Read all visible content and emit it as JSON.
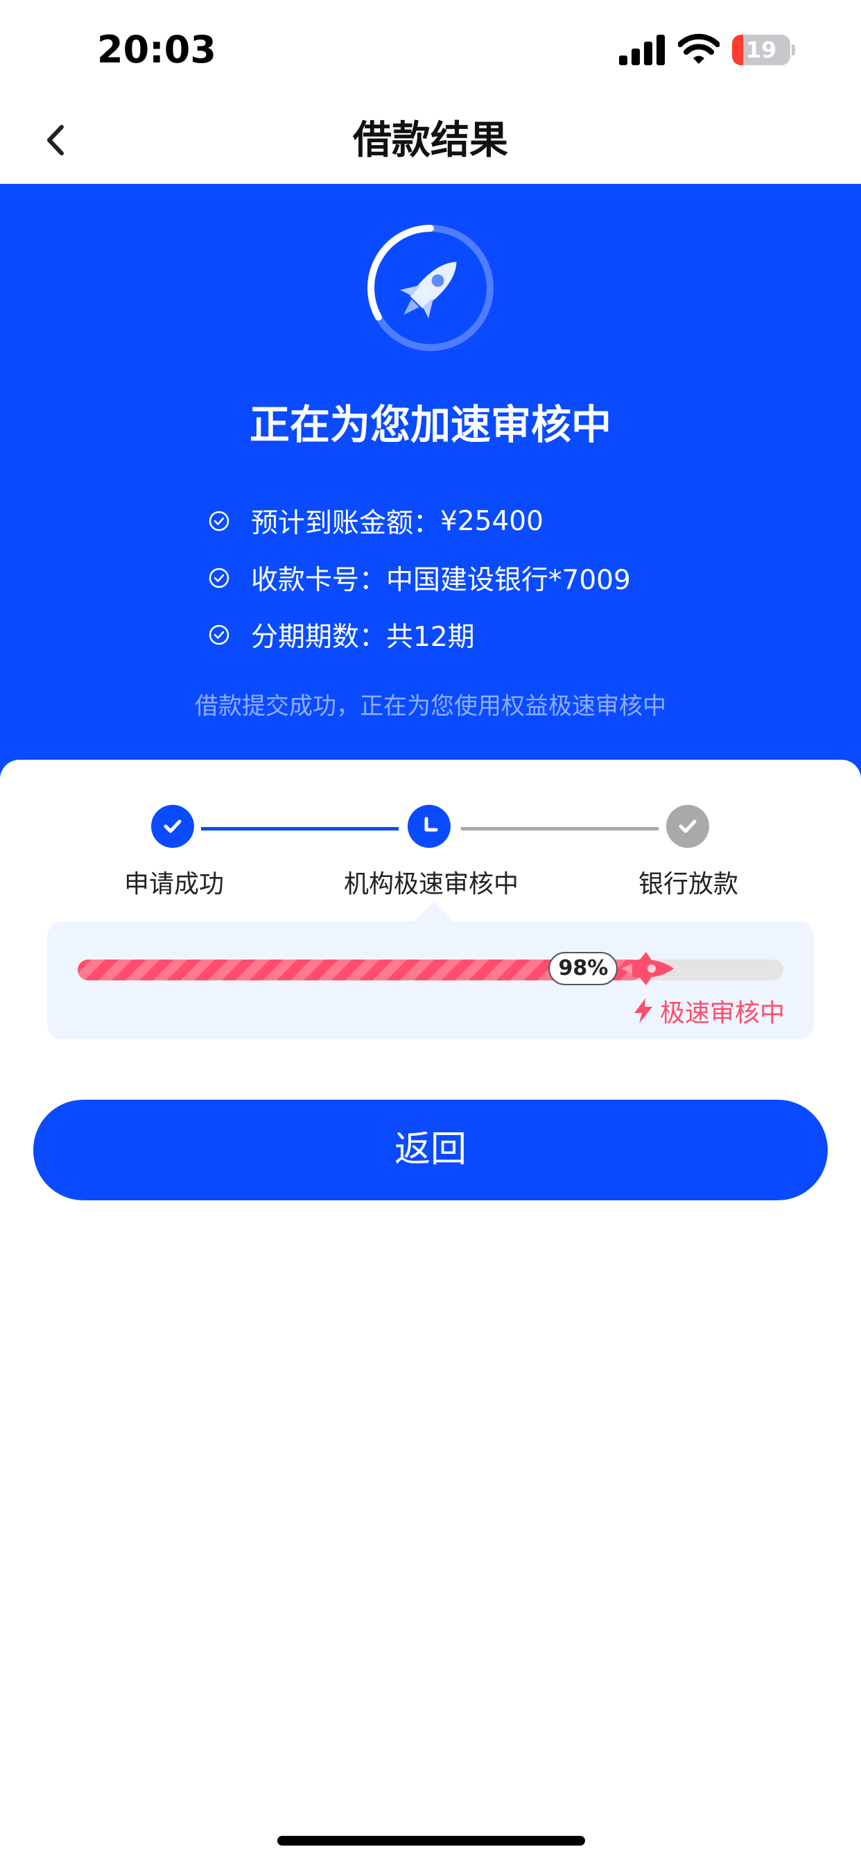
{
  "status_bar": {
    "time": "20:03",
    "battery": "19",
    "battery_level": 0.19
  },
  "nav": {
    "title": "借款结果"
  },
  "hero": {
    "title": "正在为您加速审核中",
    "info": [
      {
        "label": "预计到账金额：",
        "value": "¥25400"
      },
      {
        "label": "收款卡号：",
        "value": "中国建设银行*7009"
      },
      {
        "label": "分期期数：",
        "value": "共12期"
      }
    ],
    "note": "借款提交成功，正在为您使用权益极速审核中"
  },
  "steps": [
    {
      "label": "申请成功",
      "state": "done"
    },
    {
      "label": "机构极速审核中",
      "state": "active"
    },
    {
      "label": "银行放款",
      "state": "pending"
    }
  ],
  "progress": {
    "percent_label": "98%",
    "value": 0.8,
    "status": "极速审核中"
  },
  "actions": {
    "return_label": "返回"
  },
  "colors": {
    "primary": "#0a4bff",
    "progress": "#ff4d6d",
    "pending": "#a9a9a9"
  }
}
